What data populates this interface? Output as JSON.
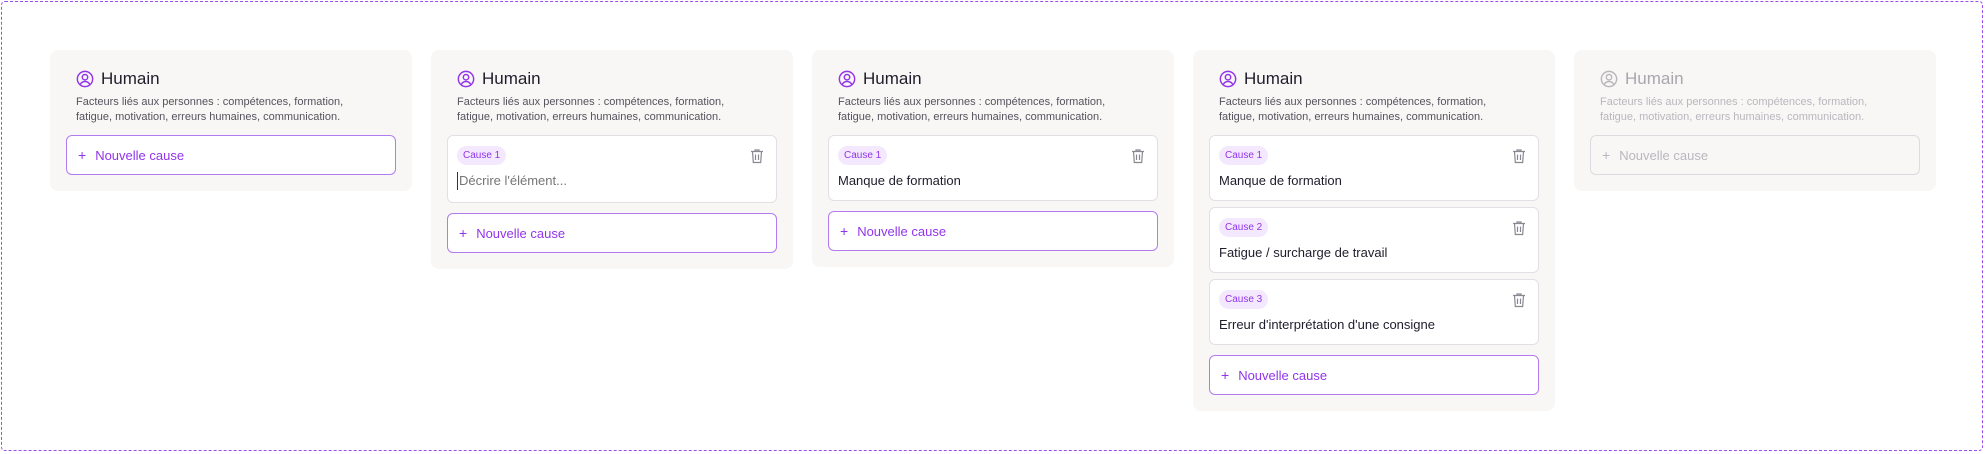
{
  "colors": {
    "accent": "#9234ea",
    "badge_bg": "#f3e8fd",
    "frame_border": "#9b4dea",
    "card_bg": "#f8f7f6",
    "disabled_text": "#b9b7bd"
  },
  "category": {
    "icon": "user-circle-icon",
    "title": "Humain",
    "description": "Facteurs liés aux personnes : compétences, formation, fatigue, motivation, erreurs humaines, communication."
  },
  "add_button_label": "Nouvelle cause",
  "add_button_icon": "plus-icon",
  "delete_icon": "trash-icon",
  "states": [
    {
      "name": "empty",
      "causes": []
    },
    {
      "name": "editing",
      "causes": [
        {
          "badge": "Cause 1",
          "text": "",
          "placeholder": "Décrire l'élément..."
        }
      ]
    },
    {
      "name": "one-cause",
      "causes": [
        {
          "badge": "Cause 1",
          "text": "Manque de formation"
        }
      ]
    },
    {
      "name": "three-causes",
      "causes": [
        {
          "badge": "Cause 1",
          "text": "Manque de formation"
        },
        {
          "badge": "Cause 2",
          "text": "Fatigue / surcharge de travail"
        },
        {
          "badge": "Cause 3",
          "text": "Erreur d'interprétation d'une consigne"
        }
      ]
    },
    {
      "name": "disabled",
      "causes": []
    }
  ]
}
